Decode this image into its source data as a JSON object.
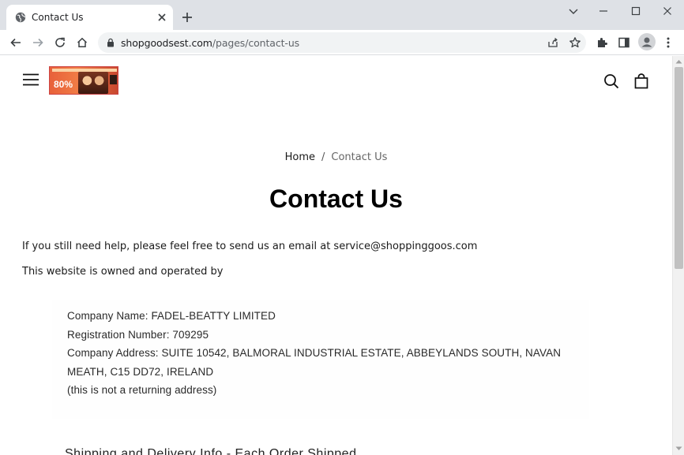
{
  "browser": {
    "tab_title": "Contact Us",
    "url_domain": "shopgoodsest.com",
    "url_path": "/pages/contact-us"
  },
  "site": {
    "logo_text": "80%",
    "breadcrumb": {
      "home": "Home",
      "separator": "/",
      "current": "Contact Us"
    },
    "page_title": "Contact Us",
    "paragraphs": {
      "help": "If you still need help, please feel free to send us an email at service@shoppinggoos.com",
      "owned": "This website is owned and operated by"
    },
    "company": {
      "name_line": "Company Name: FADEL-BEATTY LIMITED",
      "registration_line": "Registration Number: 709295",
      "address_line1": "Company Address: SUITE 10542, BALMORAL INDUSTRIAL ESTATE, ABBEYLANDS SOUTH, NAVAN",
      "address_line2": "MEATH, C15 DD72, IRELAND",
      "note_line": "(this is not a returning address)"
    },
    "cut_text": "Shipping and Delivery Info - Each Order Shipped"
  },
  "colors": {
    "chrome_bg": "#dee1e6",
    "omnibox_bg": "#f1f3f4",
    "logo_accent": "#e8613a"
  }
}
